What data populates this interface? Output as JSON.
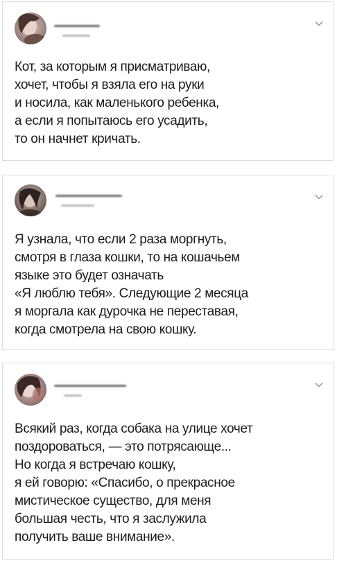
{
  "tweets": [
    {
      "lines": [
        "Кот, за которым я присматриваю,",
        "хочет, чтобы я взяла его на руки",
        "и носила, как маленького ребенка,",
        "а если я попытаюсь его усадить,",
        "то он начнет кричать."
      ]
    },
    {
      "lines": [
        "Я узнала, что если 2 раза моргнуть,",
        "смотря в глаза кошки, то на кошачьем",
        "языке это будет означать",
        "«Я люблю тебя». Следующие 2 месяца",
        "я моргала как дурочка не переставая,",
        "когда смотрела на свою кошку."
      ]
    },
    {
      "lines": [
        "Всякий раз, когда собака на улице хочет",
        "поздороваться, — это потрясающе...",
        "Но когда я встречаю кошку,",
        "я ей говорю: «Спасибо, о прекрасное",
        "мистическое существо, для меня",
        "большая честь, что я заслужила",
        "получить ваше внимание»."
      ]
    }
  ],
  "icons": {
    "avatar": "avatar-photo-icon",
    "more": "chevron-down-icon"
  }
}
